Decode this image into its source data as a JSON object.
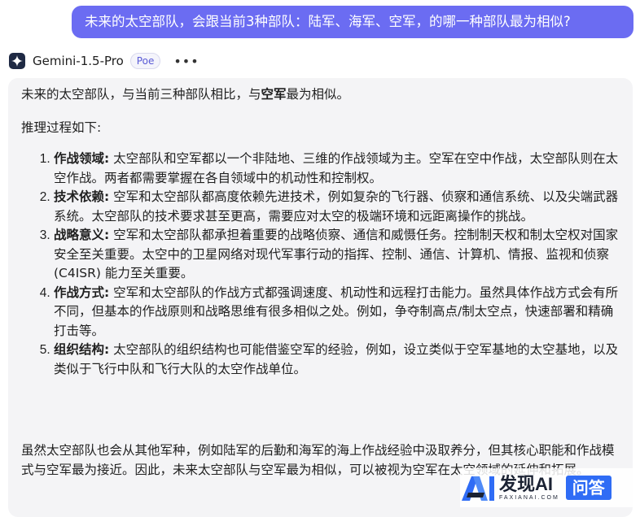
{
  "user_message": "未来的太空部队，会跟当前3种部队：陆军、海军、空军，的哪一种部队最为相似?",
  "bot": {
    "name": "Gemini-1.5-Pro",
    "badge": "Poe",
    "more_label": "•••",
    "avatar_icon": "sparkle-icon"
  },
  "answer": {
    "intro_before": "未来的太空部队，与当前三种部队相比，与",
    "intro_bold": "空军",
    "intro_after": "最为相似。",
    "reasoning_label": "推理过程如下:",
    "items": [
      {
        "title": "作战领域:",
        "text": " 太空部队和空军都以一个非陆地、三维的作战领域为主。空军在空中作战，太空部队则在太空作战。两者都需要掌握在各自领域中的机动性和控制权。"
      },
      {
        "title": "技术依赖:",
        "text": " 空军和太空部队都高度依赖先进技术，例如复杂的飞行器、侦察和通信系统、以及尖端武器系统。太空部队的技术要求甚至更高，需要应对太空的极端环境和远距离操作的挑战。"
      },
      {
        "title": "战略意义:",
        "text": " 空军和太空部队都承担着重要的战略侦察、通信和威慑任务。控制制天权和制太空权对国家安全至关重要。太空中的卫星网络对现代军事行动的指挥、控制、通信、计算机、情报、监视和侦察 (C4ISR) 能力至关重要。"
      },
      {
        "title": "作战方式:",
        "text": " 空军和太空部队的作战方式都强调速度、机动性和远程打击能力。虽然具体作战方式会有所不同，但基本的作战原则和战略思维有很多相似之处。例如，争夺制高点/制太空点，快速部署和精确打击等。"
      },
      {
        "title": "组织结构:",
        "text": " 太空部队的组织结构也可能借鉴空军的经验，例如，设立类似于空军基地的太空基地，以及类似于飞行中队和飞行大队的太空作战单位。"
      }
    ],
    "conclusion": "虽然太空部队也会从其他军种，例如陆军的后勤和海军的海上作战经验中汲取养分，但其核心职能和作战模式与空军最为接近。因此，未来太空部队与空军最为相似，可以被视为空军在太空领域的延伸和拓展。"
  },
  "watermark": {
    "brand": "发现AI",
    "url": "FAXIANAI.COM",
    "tag": "问答",
    "logo_icon": "ai-logo-icon"
  },
  "colors": {
    "user_bubble": "#6b6cf2",
    "bot_bubble": "#f4f4f6",
    "badge_text": "#5a5bd6",
    "watermark_tag": "#2f6cf5"
  }
}
